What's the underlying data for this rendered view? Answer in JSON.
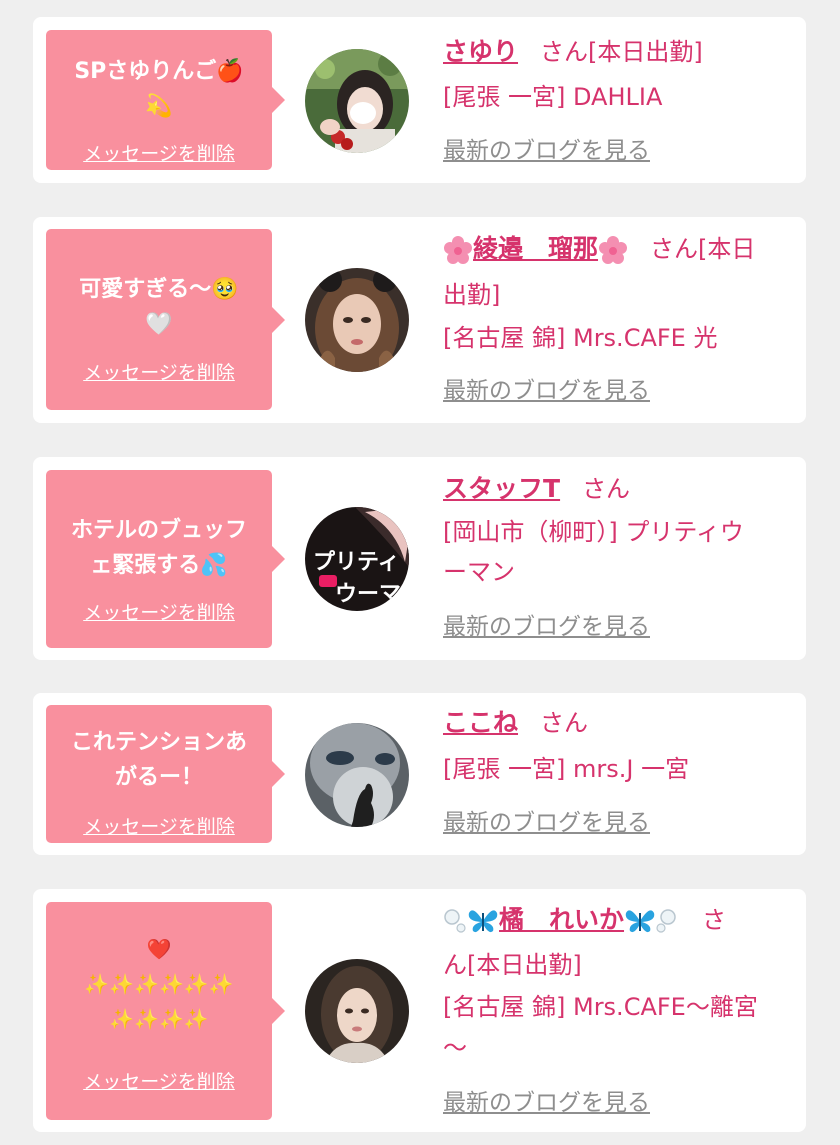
{
  "favorites": [
    {
      "message_lines": [
        "SPさゆりんご🍎",
        "💫"
      ],
      "delete_label": "メッセージを削除",
      "name": "さゆり",
      "honorific": "さん",
      "status": "[本日出勤]",
      "area_shop": "[尾張 一宮] DAHLIA",
      "blog_label": "最新のブログを見る"
    },
    {
      "message_lines": [
        "可愛すぎる〜🥹",
        "🤍"
      ],
      "delete_label": "メッセージを削除",
      "name": "綾邉　瑠那",
      "honorific": "さん[本日",
      "status": "出勤]",
      "area_shop": "[名古屋 錦] Mrs.CAFE 光",
      "blog_label": "最新のブログを見る"
    },
    {
      "message_lines": [
        "ホテルのブュッフ",
        "ェ緊張する💦"
      ],
      "delete_label": "メッセージを削除",
      "name": "スタッフT",
      "honorific": "さん",
      "area_shop_line1": "[岡山市（柳町）] プリティウ",
      "area_shop_line2": "ーマン",
      "avatar_text_1": "プリティ",
      "avatar_text_2": "ウーマ",
      "blog_label": "最新のブログを見る"
    },
    {
      "message_lines": [
        "これテンションあ",
        "がるー！"
      ],
      "delete_label": "メッセージを削除",
      "name": "ここね",
      "honorific": "さん",
      "area_shop": "[尾張 一宮] mrs.J 一宮",
      "blog_label": "最新のブログを見る"
    },
    {
      "message_lines": [
        "❤️",
        "✨✨✨✨✨✨",
        "✨✨✨✨"
      ],
      "delete_label": "メッセージを削除",
      "name": "橘　れいか",
      "honorific_line1": "さ",
      "honorific_line2": "ん[本日出勤]",
      "area_shop_line1": "[名古屋 錦] Mrs.CAFE〜離宮",
      "area_shop_line2": "〜",
      "blog_label": "最新のブログを見る"
    }
  ],
  "colors": {
    "accent": "#d6336c",
    "bubble": "#f9909e",
    "link_gray": "#8e8e8e",
    "background": "#efefef"
  }
}
